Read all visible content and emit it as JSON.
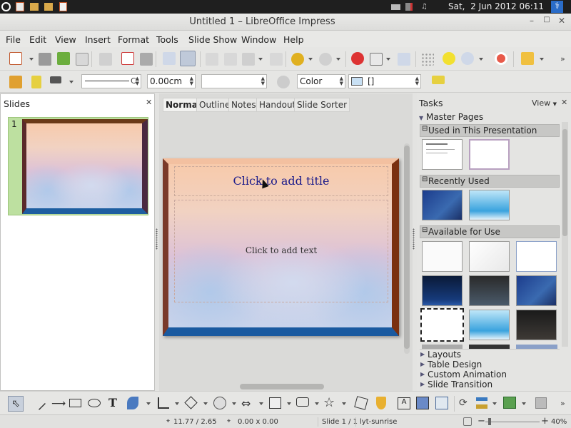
{
  "topbar": {
    "datetime": "Sat,  2 Jun 2012 06:11"
  },
  "window": {
    "title": "Untitled 1 – LibreOffice Impress"
  },
  "menu": [
    "File",
    "Edit",
    "View",
    "Insert",
    "Format",
    "Tools",
    "Slide Show",
    "Window",
    "Help"
  ],
  "toolbar2": {
    "line_width": "0.00cm",
    "area_style": "Color"
  },
  "slides_panel": {
    "title": "Slides",
    "slide_number": "1"
  },
  "view_tabs": [
    "Normal",
    "Outline",
    "Notes",
    "Handout",
    "Slide Sorter"
  ],
  "slide": {
    "title_placeholder": "Click to add title",
    "text_placeholder": "Click to add text"
  },
  "tasks": {
    "title": "Tasks",
    "view_label": "View",
    "master_pages": "Master Pages",
    "used": "Used in This Presentation",
    "recent": "Recently Used",
    "available": "Available for Use",
    "layouts": "Layouts",
    "table_design": "Table Design",
    "custom_animation": "Custom Animation",
    "slide_transition": "Slide Transition"
  },
  "status": {
    "position": "11.77 / 2.65",
    "size": "0.00 x 0.00",
    "slide": "Slide 1 / 1",
    "master": "lyt-sunrise",
    "zoom": "40%"
  },
  "colors": {
    "title_text": "#1a1a8a",
    "accent": "#1e5ea0"
  }
}
